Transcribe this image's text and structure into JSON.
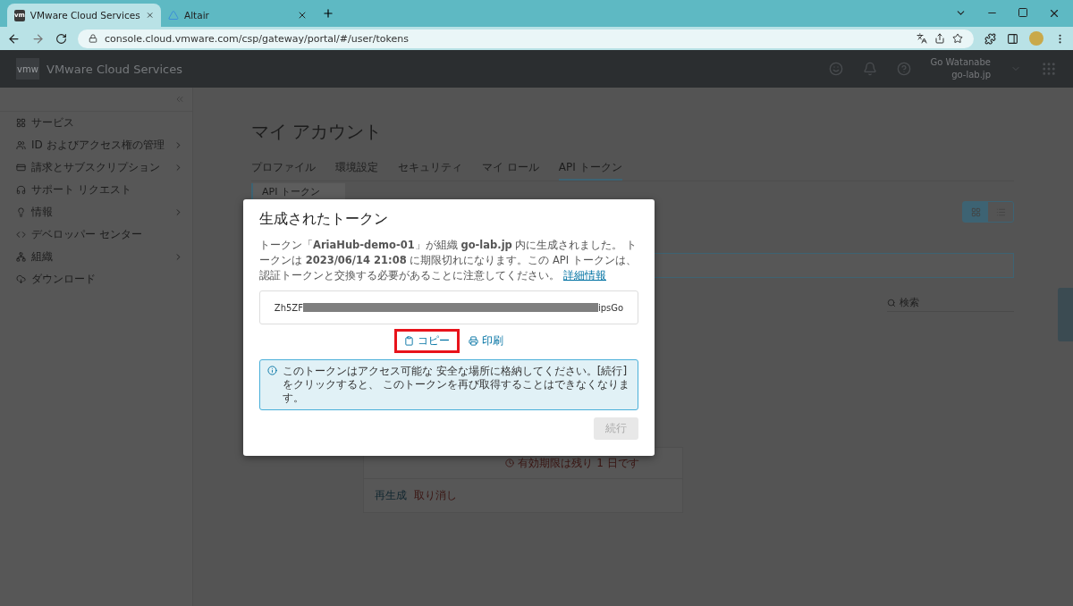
{
  "browser": {
    "tabs": [
      {
        "favicon": "vm",
        "title": "VMware Cloud Services",
        "selected": true
      },
      {
        "title": "Altair",
        "selected": false
      }
    ],
    "url": "console.cloud.vmware.com/csp/gateway/portal/#/user/tokens"
  },
  "header": {
    "logo": "vmw",
    "title": "VMware Cloud Services",
    "user_name": "Go Watanabe",
    "org": "go-lab.jp"
  },
  "sidebar": {
    "items": [
      {
        "label": "サービス",
        "expandable": false
      },
      {
        "label": "ID およびアクセス権の管理",
        "expandable": true
      },
      {
        "label": "請求とサブスクリプション",
        "expandable": true
      },
      {
        "label": "サポート リクエスト",
        "expandable": false
      },
      {
        "label": "情報",
        "expandable": true
      },
      {
        "label": "デベロッパー センター",
        "expandable": false
      },
      {
        "label": "組織",
        "expandable": true
      },
      {
        "label": "ダウンロード",
        "expandable": false
      }
    ]
  },
  "page": {
    "title": "マイ アカウント",
    "tabs": [
      {
        "label": "プロファイル",
        "selected": false
      },
      {
        "label": "環境設定",
        "selected": false
      },
      {
        "label": "セキュリティ",
        "selected": false
      },
      {
        "label": "マイ ロール",
        "selected": false
      },
      {
        "label": "API トークン",
        "selected": true
      }
    ],
    "subnav": [
      {
        "label": "API トークン",
        "selected": true
      }
    ],
    "view_toggle": [
      {
        "kind": "grid",
        "selected": true
      },
      {
        "kind": "list",
        "selected": false
      }
    ],
    "search": {
      "placeholder": "検索"
    },
    "token_card": {
      "expiry": "有効期限は残り 1 日です",
      "actions": [
        "再生成",
        "取り消し"
      ]
    }
  },
  "dialog": {
    "title": "生成されたトークン",
    "message": "トークン「**AriaHub-demo-01**」が組織 **go-lab.jp** 内に生成されました。 トークンは **2023/06/14 21:08** に期限切れになります。この API トークンは、認証トークンと交換する必要があることに注意してください。",
    "link": "詳細情報",
    "token_start": "Zh5ZF",
    "token_end": "ipsGo",
    "copy": {
      "label": "コピー",
      "highlighted": true
    },
    "print": {
      "label": "印刷"
    },
    "alert": "このトークンはアクセス可能な 安全な場所に格納してください。[続行] をクリックすると、 このトークンを再び取得することはできなくなります。",
    "continue": {
      "label": "続行",
      "disabled": true
    }
  }
}
